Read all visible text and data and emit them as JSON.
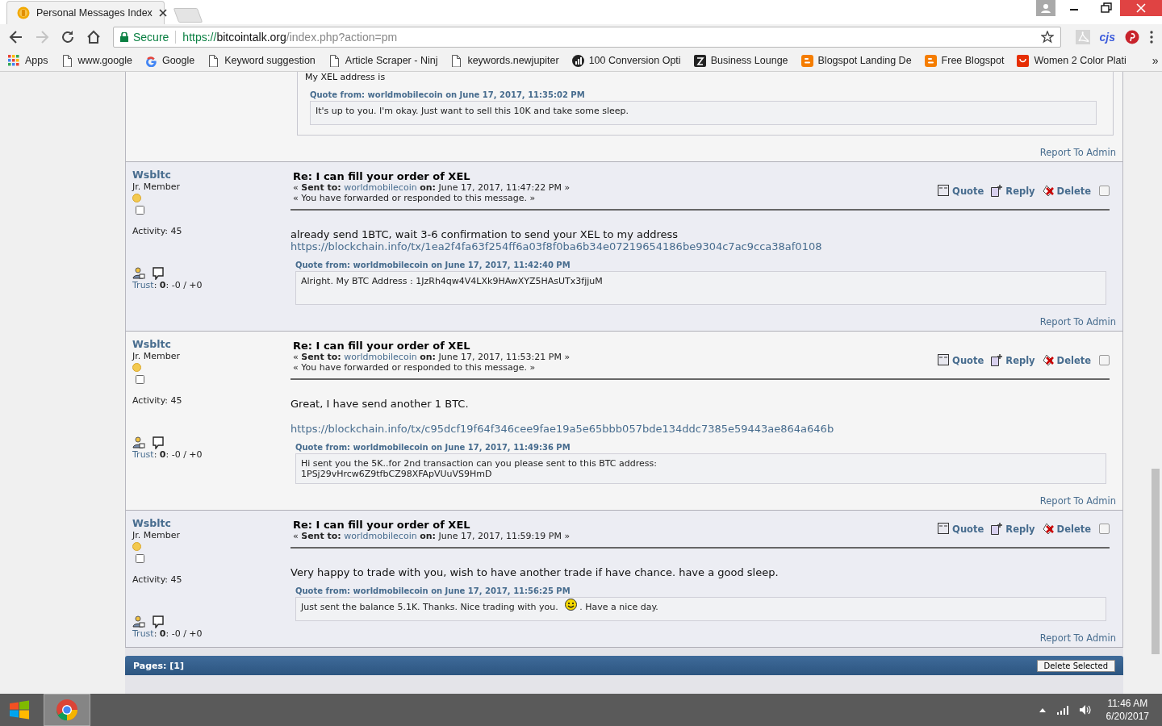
{
  "browser": {
    "tab": {
      "title": "Personal Messages Index",
      "selected": true
    },
    "address": {
      "secure_label": "Secure",
      "scheme": "https://",
      "host": "bitcointalk.org",
      "path": "/index.php?action=pm"
    },
    "forward_disabled": true,
    "extensions": [
      {
        "kind": "pdf"
      },
      {
        "kind": "text",
        "label": "cjs"
      },
      {
        "kind": "pinterest"
      }
    ],
    "bookmarks": [
      {
        "kind": "apps",
        "label": "Apps"
      },
      {
        "kind": "page",
        "label": "www.google"
      },
      {
        "kind": "google",
        "label": "Google"
      },
      {
        "kind": "page",
        "label": "Keyword suggestion"
      },
      {
        "kind": "page",
        "label": "Article Scraper - Ninj"
      },
      {
        "kind": "page",
        "label": "keywords.newjupiter"
      },
      {
        "kind": "chart",
        "label": "100 Conversion Opti"
      },
      {
        "kind": "dark",
        "label": "Business Lounge"
      },
      {
        "kind": "blogger",
        "label": "Blogspot Landing De"
      },
      {
        "kind": "blogger",
        "label": "Free Blogspot"
      },
      {
        "kind": "shop",
        "label": "Women 2 Color Plati"
      }
    ],
    "more_bookmarks": "»"
  },
  "partial_post": {
    "body": "My XEL address is",
    "quote": {
      "header": "Quote from: worldmobilecoin on June 17, 2017, 11:35:02 PM",
      "lines": [
        [
          {
            "kind": "text",
            "text": "It's up to you. I'm okay. Just want to sell this 10K and take some sleep."
          }
        ]
      ]
    },
    "report": "Report To Admin"
  },
  "posts": [
    {
      "author": "Wsbltc",
      "rank": "Jr. Member",
      "activity": "Activity: 45",
      "trust_link": "Trust",
      "trust_rest": ": **0**: -0 / +0",
      "subject": "Re: I can fill your order of XEL",
      "sent_prefix": "« **Sent to:**",
      "recipient": "worldmobilecoin",
      "sent_suffix": "**on:** June 17, 2017, 11:47:22 PM »",
      "forwarded": "« You have forwarded or responded to this message. »",
      "actions": [
        "Quote",
        "Reply",
        "Delete"
      ],
      "checked": false,
      "body": [
        {
          "kind": "text",
          "text": "already send 1BTC, wait 3-6 confirmation to send your XEL to my address"
        },
        {
          "kind": "link",
          "text": "https://blockchain.info/tx/1ea2f4fa63f254ff6a03f8f0ba6b34e07219654186be9304c7ac9cca38af0108"
        }
      ],
      "quote": {
        "header": "Quote from: worldmobilecoin on June 17, 2017, 11:42:40 PM",
        "lines": [
          [
            {
              "kind": "text",
              "text": "Alright. My BTC Address : 1JzRh4qw4V4LXk9HAwXYZ5HAsUTx3fjjuM"
            }
          ]
        ]
      },
      "report": "Report To Admin"
    },
    {
      "author": "Wsbltc",
      "rank": "Jr. Member",
      "activity": "Activity: 45",
      "trust_link": "Trust",
      "trust_rest": ": **0**: -0 / +0",
      "subject": "Re: I can fill your order of XEL",
      "sent_prefix": "« **Sent to:**",
      "recipient": "worldmobilecoin",
      "sent_suffix": "**on:** June 17, 2017, 11:53:21 PM »",
      "forwarded": "« You have forwarded or responded to this message. »",
      "actions": [
        "Quote",
        "Reply",
        "Delete"
      ],
      "checked": false,
      "body": [
        {
          "kind": "text",
          "text": "Great, I have send another 1 BTC."
        },
        {
          "kind": "gap"
        },
        {
          "kind": "link",
          "text": "https://blockchain.info/tx/c95dcf19f64f346cee9fae19a5e65bbb057bde134ddc7385e59443ae864a646b"
        }
      ],
      "quote": {
        "header": "Quote from: worldmobilecoin on June 17, 2017, 11:49:36 PM",
        "lines": [
          [
            {
              "kind": "text",
              "text": "Hi sent you the 5K..for 2nd transaction can you please sent to this BTC address:"
            }
          ],
          [
            {
              "kind": "text",
              "text": "1PSj29vHrcw6Z9tfbCZ98XFApVUuVS9HmD"
            }
          ]
        ]
      },
      "report": "Report To Admin"
    },
    {
      "author": "Wsbltc",
      "rank": "Jr. Member",
      "activity": "Activity: 45",
      "trust_link": "Trust",
      "trust_rest": ": **0**: -0 / +0",
      "subject": "Re: I can fill your order of XEL",
      "sent_prefix": "« **Sent to:**",
      "recipient": "worldmobilecoin",
      "sent_suffix": "**on:** June 17, 2017, 11:59:19 PM »",
      "actions": [
        "Quote",
        "Reply",
        "Delete"
      ],
      "checked": false,
      "body": [
        {
          "kind": "text",
          "text": "Very happy to trade with you, wish to have another trade if have chance. have a good sleep."
        }
      ],
      "quote": {
        "header": "Quote from: worldmobilecoin on June 17, 2017, 11:56:25 PM",
        "lines": [
          [
            {
              "kind": "text",
              "text": "Just sent the balance 5.1K. Thanks. Nice trading with you. "
            },
            {
              "kind": "smiley"
            },
            {
              "kind": "text",
              "text": ". Have a nice day."
            }
          ]
        ]
      },
      "report": "Report To Admin"
    }
  ],
  "footer": {
    "pages": "Pages: [1]",
    "button": "Delete Selected"
  },
  "taskbar": {
    "time": "11:46 AM",
    "date": "6/20/2017"
  }
}
